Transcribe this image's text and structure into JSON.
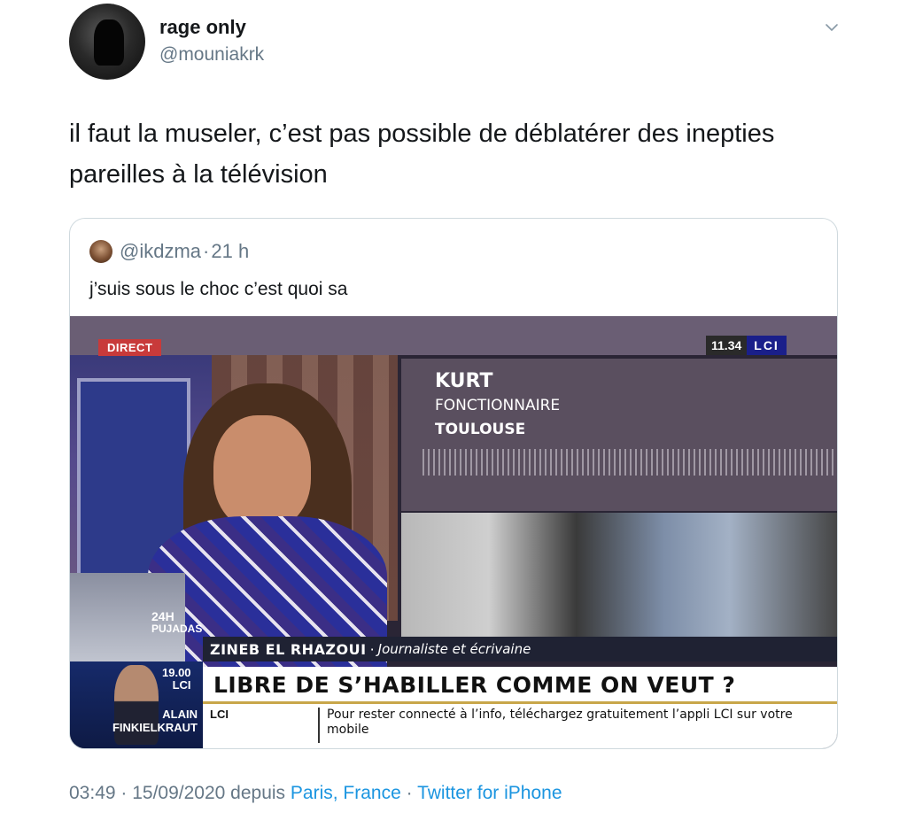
{
  "tweet": {
    "author": {
      "name": "rage only",
      "handle": "@mouniakrk"
    },
    "text": "il faut la museler, c’est pas possible de déblatérer des inepties pareilles à la télévision",
    "timestamp": "03:49 · 15/09/2020",
    "from_word": "depuis",
    "location": "Paris, France",
    "separator": "·",
    "client": "Twitter for iPhone"
  },
  "quoted_tweet": {
    "handle": "@ikdzma",
    "separator": "·",
    "time": "21 h",
    "text": "j’suis sous le choc c’est quoi sa",
    "video": {
      "tag": "DIRECT",
      "clock": "11.34",
      "channel_logo": "LCI",
      "inset_name": "KURT",
      "inset_role": "FONCTIONNAIRE",
      "inset_city": "TOULOUSE",
      "guest_tag_line1": "24H",
      "guest_tag_line2": "PUJADAS",
      "speaker_name": "ZINEB EL RHAZOUI",
      "speaker_sep": "·",
      "speaker_role": "Journaliste et écrivaine",
      "side_time": "19.00",
      "side_channel": "LCI",
      "side_name_line1": "ALAIN",
      "side_name_line2": "FINKIELKRAUT",
      "headline": "LIBRE DE S’HABILLER COMME ON VEUT ?",
      "ticker_source": "LCI",
      "ticker_text": "Pour rester connecté à l’info, téléchargez gratuitement l’appli LCI sur votre mobile"
    }
  },
  "icons": {
    "menu": "chevron-down-icon"
  },
  "colors": {
    "link": "#1b95e0",
    "secondary_text": "#657786",
    "primary_text": "#14171a"
  }
}
